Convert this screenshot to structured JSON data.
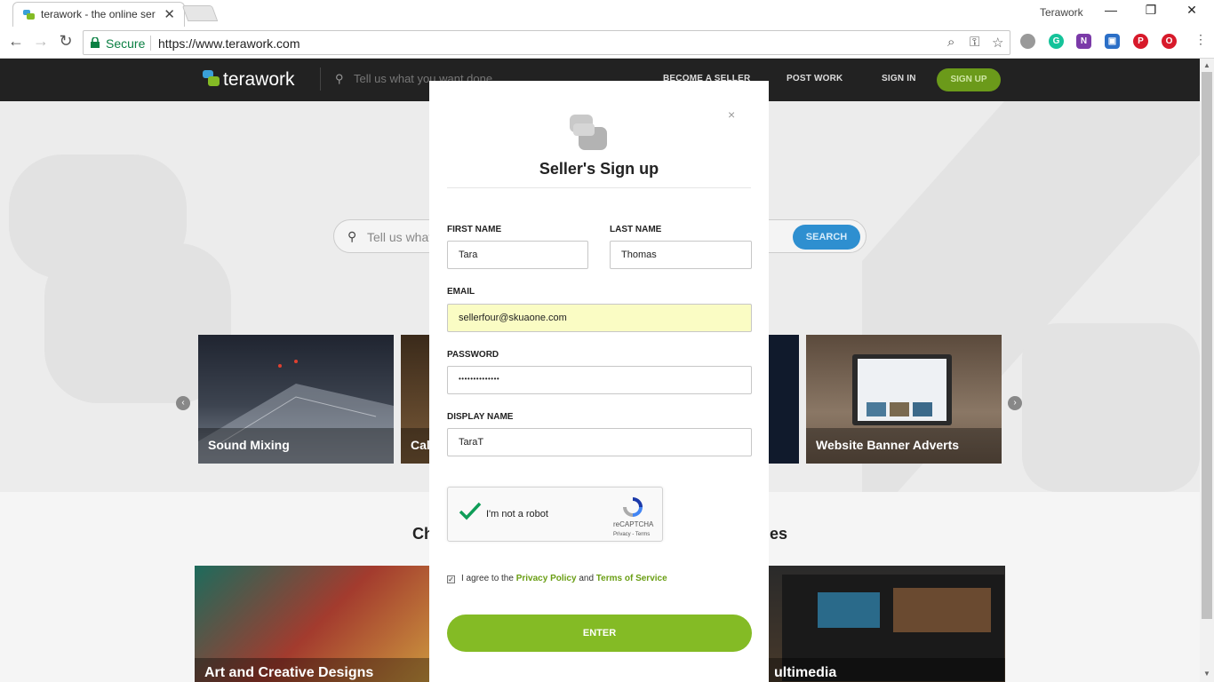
{
  "browser": {
    "tab_title": "terawork - the online ser",
    "profile_name": "Terawork",
    "secure_label": "Secure",
    "url": "https://www.terawork.com"
  },
  "site_header": {
    "logo_text": "terawork",
    "search_placeholder": "Tell us what you want done",
    "become_seller": "BECOME A SELLER",
    "post_work": "POST WORK",
    "sign_in": "SIGN IN",
    "sign_up": "SIGN UP"
  },
  "hero": {
    "search_placeholder": "Tell us what",
    "search_button": "SEARCH",
    "cards": [
      "Sound Mixing",
      "Cal",
      "Website Banner Adverts"
    ]
  },
  "categories": {
    "title_left": "Ch",
    "title_right": "es",
    "cards": [
      "Art and Creative Designs",
      "ultimedia"
    ]
  },
  "modal": {
    "close": "×",
    "title": "Seller's Sign up",
    "first_name_label": "FIRST NAME",
    "first_name_value": "Tara",
    "last_name_label": "LAST NAME",
    "last_name_value": "Thomas",
    "email_label": "EMAIL",
    "email_value": "sellerfour@skuaone.com",
    "password_label": "PASSWORD",
    "password_value": "••••••••••••••",
    "display_name_label": "DISPLAY NAME",
    "display_name_value": "TaraT",
    "recaptcha_label": "I'm not a robot",
    "recaptcha_brand": "reCAPTCHA",
    "recaptcha_terms": "Privacy - Terms",
    "agree_prefix": "I agree to the",
    "privacy_policy": "Privacy Policy",
    "agree_and": "and",
    "terms_of_service": "Terms of Service",
    "agree_checked": true,
    "enter_button": "ENTER"
  },
  "colors": {
    "brand_green": "#84bb25",
    "header_bg": "#222222",
    "search_blue": "#2e8fd0",
    "autofill_yellow": "#fafcc4"
  }
}
